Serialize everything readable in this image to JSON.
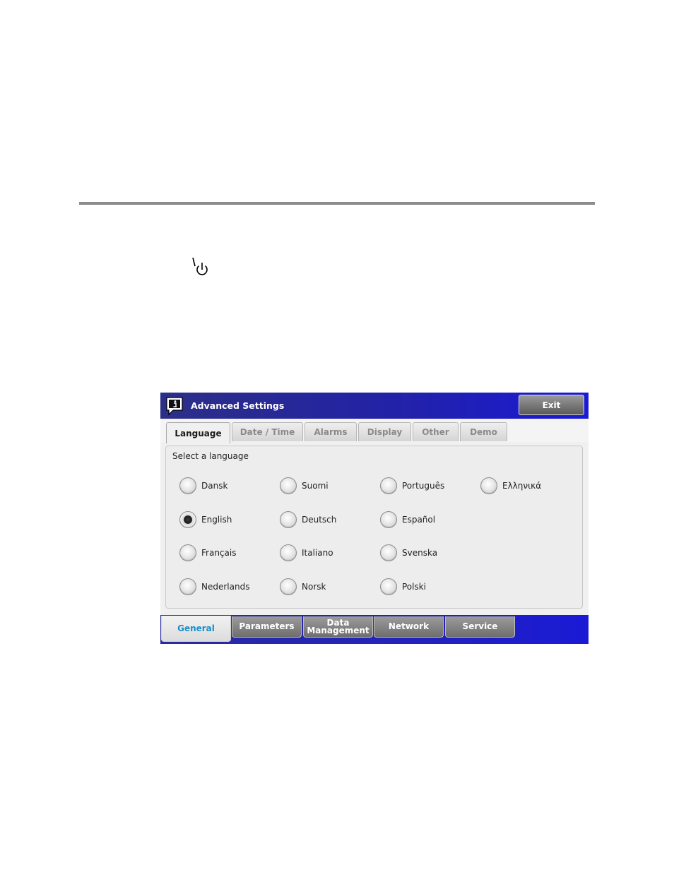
{
  "window": {
    "title": "Advanced Settings",
    "exit_label": "Exit"
  },
  "top_tabs": [
    {
      "label": "Language",
      "active": true
    },
    {
      "label": "Date / Time",
      "active": false
    },
    {
      "label": "Alarms",
      "active": false
    },
    {
      "label": "Display",
      "active": false
    },
    {
      "label": "Other",
      "active": false
    },
    {
      "label": "Demo",
      "active": false
    }
  ],
  "panel": {
    "label": "Select a language",
    "languages": [
      {
        "label": "Dansk",
        "selected": false
      },
      {
        "label": "English",
        "selected": true
      },
      {
        "label": "Français",
        "selected": false
      },
      {
        "label": "Nederlands",
        "selected": false
      },
      {
        "label": "Suomi",
        "selected": false
      },
      {
        "label": "Deutsch",
        "selected": false
      },
      {
        "label": "Italiano",
        "selected": false
      },
      {
        "label": "Norsk",
        "selected": false
      },
      {
        "label": "Português",
        "selected": false
      },
      {
        "label": "Español",
        "selected": false
      },
      {
        "label": "Svenska",
        "selected": false
      },
      {
        "label": "Polski",
        "selected": false
      },
      {
        "label": "Ελληνικά",
        "selected": false
      }
    ]
  },
  "bottom_tabs": [
    {
      "label": "General",
      "active": true
    },
    {
      "label": "Parameters",
      "active": false
    },
    {
      "label": "Data Management",
      "label_line1": "Data",
      "label_line2": "Management",
      "active": false
    },
    {
      "label": "Network",
      "active": false
    },
    {
      "label": "Service",
      "active": false
    }
  ],
  "icons": {
    "power": "power-standby-icon",
    "info": "info-message-icon"
  },
  "colors": {
    "titlebar_blue": "#2222a8",
    "active_bottom_tab_text": "#1a8fc9"
  }
}
